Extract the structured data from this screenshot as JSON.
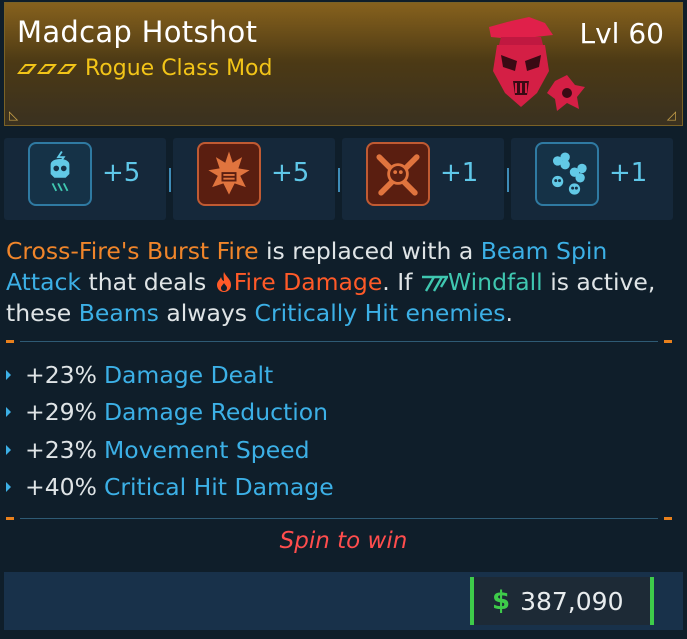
{
  "item": {
    "name": "Madcap Hotshot",
    "level": "Lvl 60",
    "type": "Rogue Class Mod",
    "rarity_icon": "triple-chevron-icon",
    "icon": "madcap-hotshot-class-mod-icon"
  },
  "skills": [
    {
      "icon": "skull-lightning-icon",
      "bonus": "+5",
      "style": "blue"
    },
    {
      "icon": "fire-burst-icon",
      "bonus": "+5",
      "style": "orange"
    },
    {
      "icon": "crossed-weapons-icon",
      "bonus": "+1",
      "style": "orange"
    },
    {
      "icon": "clover-skulls-icon",
      "bonus": "+1",
      "style": "blue"
    }
  ],
  "description": {
    "p1": "Cross-Fire's Burst Fire",
    "p2": " is replaced with a ",
    "p3": "Beam Spin Attack",
    "p4": " that deals ",
    "p5": "Fire Damage",
    "p6": ". If ",
    "p7": "Windfall",
    "p8": " is active, these ",
    "p9": "Beams",
    "p10": " always ",
    "p11": "Critically Hit enemies",
    "p12": "."
  },
  "stats": [
    {
      "value": "+23%",
      "name": "Damage Dealt"
    },
    {
      "value": "+29%",
      "name": "Damage Reduction"
    },
    {
      "value": "+23%",
      "name": "Movement Speed"
    },
    {
      "value": "+40%",
      "name": "Critical Hit Damage"
    }
  ],
  "flavor_text": "Spin to win",
  "price": {
    "currency_icon": "dollar-icon",
    "symbol": "$",
    "value": "387,090"
  },
  "colors": {
    "rarity": "#f2c418",
    "highlight_orange": "#f0852a",
    "highlight_blue": "#3cb0e6",
    "fire": "#ff5a28",
    "windfall": "#3fc7b0",
    "flavor": "#ff4d4d",
    "money": "#3ecb4a"
  }
}
